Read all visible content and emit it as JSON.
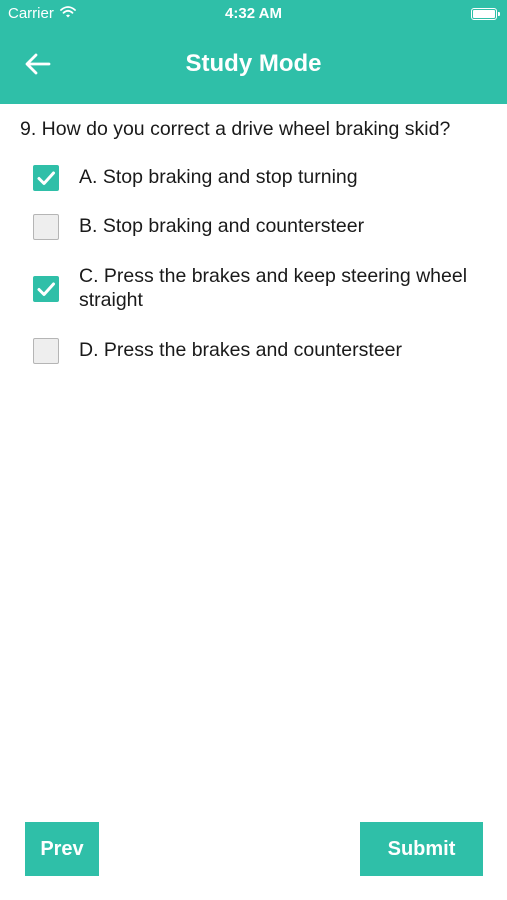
{
  "status_bar": {
    "carrier": "Carrier",
    "time": "4:32 AM"
  },
  "nav": {
    "title": "Study Mode",
    "back_icon": "arrow-left-icon"
  },
  "question": {
    "text": "9. How do you correct a drive wheel braking skid?"
  },
  "options": [
    {
      "label": "A. Stop braking and stop turning",
      "checked": true
    },
    {
      "label": "B. Stop braking and countersteer",
      "checked": false
    },
    {
      "label": "C. Press the brakes and keep steering wheel straight",
      "checked": true
    },
    {
      "label": "D. Press the brakes and countersteer",
      "checked": false
    }
  ],
  "buttons": {
    "prev": "Prev",
    "submit": "Submit"
  },
  "colors": {
    "accent": "#2fbfa8",
    "unchecked_fill": "#eeeeee",
    "unchecked_border": "#b5b5b5"
  }
}
